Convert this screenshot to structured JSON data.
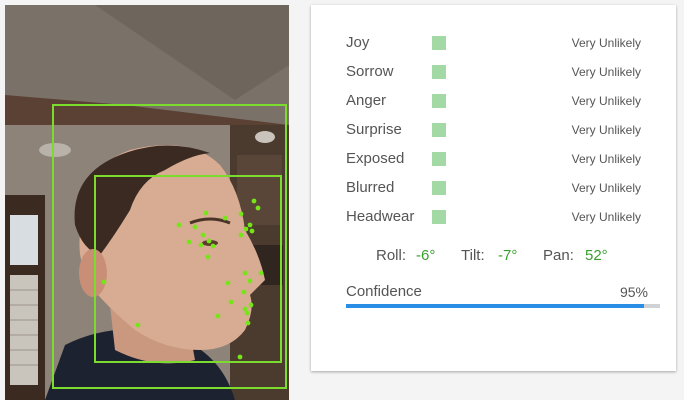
{
  "photo": {
    "alt_icon": "face-photo"
  },
  "likelihoods": [
    {
      "label": "Joy",
      "value": "Very Unlikely"
    },
    {
      "label": "Sorrow",
      "value": "Very Unlikely"
    },
    {
      "label": "Anger",
      "value": "Very Unlikely"
    },
    {
      "label": "Surprise",
      "value": "Very Unlikely"
    },
    {
      "label": "Exposed",
      "value": "Very Unlikely"
    },
    {
      "label": "Blurred",
      "value": "Very Unlikely"
    },
    {
      "label": "Headwear",
      "value": "Very Unlikely"
    }
  ],
  "colors": {
    "swatch": "#a3d9a5",
    "angle_value": "#3a9e2e",
    "box": "#7cdc2e",
    "landmark": "#77e41a",
    "bar_fill": "#2a8ee6",
    "bar_track": "#cfd3d6"
  },
  "angles": {
    "roll_label": "Roll:",
    "roll_value": "-6°",
    "tilt_label": "Tilt:",
    "tilt_value": "-7°",
    "pan_label": "Pan:",
    "pan_value": "52°"
  },
  "confidence": {
    "label": "Confidence",
    "value_text": "95%",
    "fraction": 0.95
  }
}
